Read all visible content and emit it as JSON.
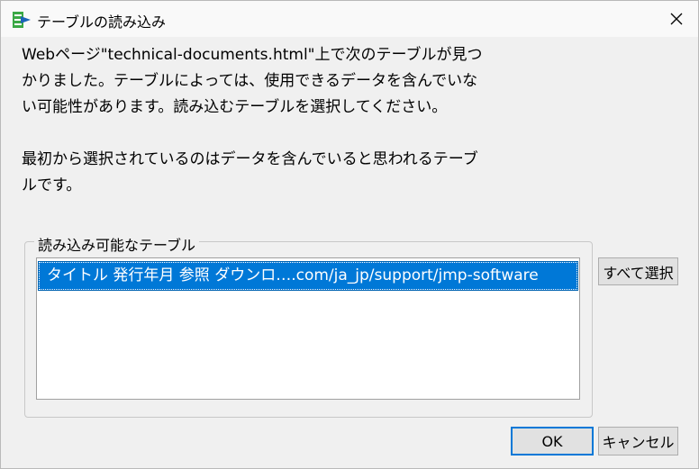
{
  "window": {
    "title": "テーブルの読み込み"
  },
  "message": {
    "line1": "Webページ\"technical-documents.html\"上で次のテーブルが見つ",
    "line2": "かりました。テーブルによっては、使用できるデータを含んでいな",
    "line3": "い可能性があります。読み込むテーブルを選択してください。",
    "line4": "最初から選択されているのはデータを含んでいると思われるテーブ",
    "line5": "ルです。"
  },
  "tables_group": {
    "label": "読み込み可能なテーブル",
    "items": [
      {
        "text": "タイトル 発行年月 参照 ダウンロ….com/ja_jp/support/jmp-software",
        "selected": true
      }
    ]
  },
  "buttons": {
    "select_all": "すべて選択",
    "ok": "OK",
    "cancel": "キャンセル"
  },
  "colors": {
    "selection": "#0078d7",
    "dialog_background": "#f0f0f0",
    "icon_green": "#3aa845",
    "icon_blue": "#1b64b8"
  },
  "icons": {
    "app": "jmp-app-icon",
    "close": "close-icon"
  }
}
